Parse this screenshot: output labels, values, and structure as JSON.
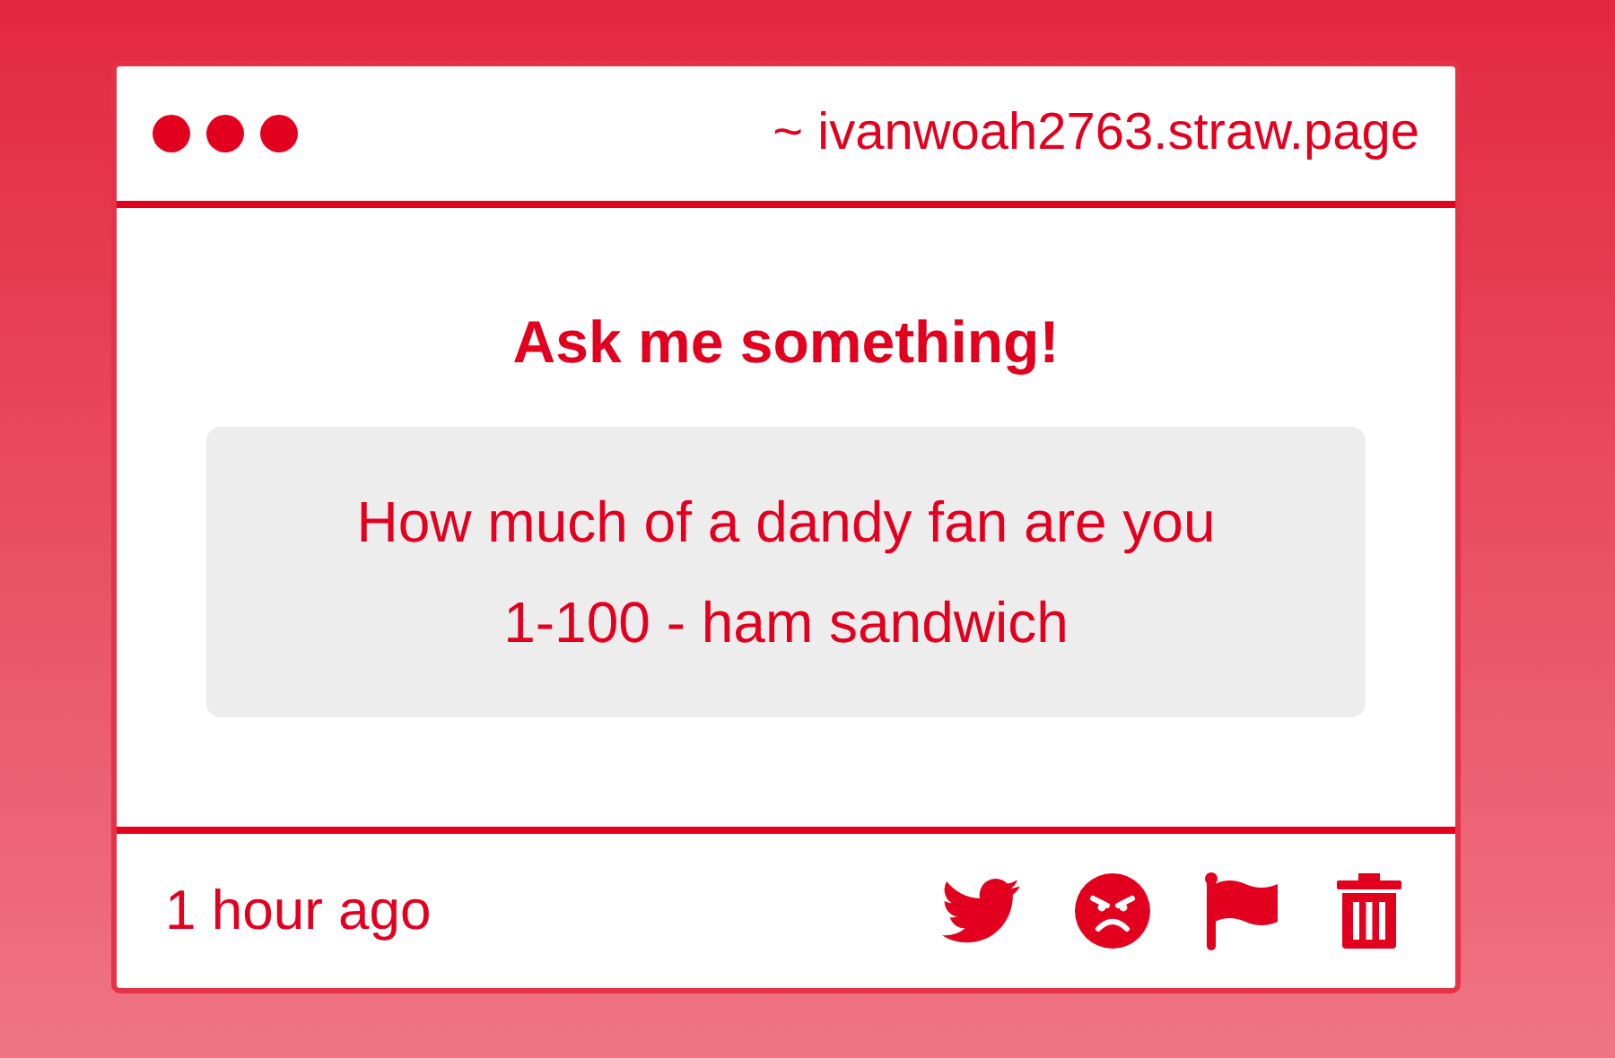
{
  "window": {
    "address": "~ ivanwoah2763.straw.page"
  },
  "heading": "Ask me something!",
  "question": "How much of a dandy fan are you 1-100 - ham sandwich",
  "footer": {
    "time": "1 hour ago",
    "actions": [
      {
        "kind": "share"
      },
      {
        "kind": "angry"
      },
      {
        "kind": "report"
      },
      {
        "kind": "delete"
      }
    ]
  }
}
